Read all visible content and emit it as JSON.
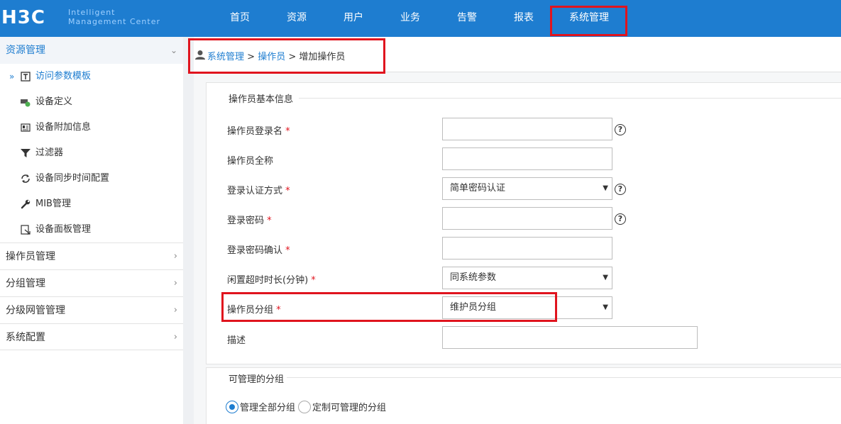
{
  "header": {
    "logo_sub1": "Intelligent",
    "logo_sub2": "Management Center",
    "nav": [
      "首页",
      "资源",
      "用户",
      "业务",
      "告警",
      "报表",
      "系统管理"
    ],
    "colors": {
      "brand": "#1e7dd0",
      "highlight": "#e0141e"
    }
  },
  "sidebar": {
    "section_title": "资源管理",
    "items": [
      {
        "label": "访问参数模板",
        "icon": "template-icon",
        "active": true
      },
      {
        "label": "设备定义",
        "icon": "device-definition-icon"
      },
      {
        "label": "设备附加信息",
        "icon": "device-info-icon"
      },
      {
        "label": "过滤器",
        "icon": "filter-icon"
      },
      {
        "label": "设备同步时间配置",
        "icon": "sync-icon"
      },
      {
        "label": "MIB管理",
        "icon": "wrench-icon"
      },
      {
        "label": "设备面板管理",
        "icon": "panel-icon"
      }
    ],
    "groups": [
      "操作员管理",
      "分组管理",
      "分级网管管理",
      "系统配置"
    ]
  },
  "breadcrumb": {
    "root": "系统管理",
    "sep1": ">",
    "mid": "操作员",
    "sep2": ">",
    "current": "增加操作员"
  },
  "form": {
    "legend": "操作员基本信息",
    "login_name_label": "操作员登录名",
    "full_name_label": "操作员全称",
    "auth_label": "登录认证方式",
    "auth_value": "简单密码认证",
    "password_label": "登录密码",
    "password_confirm_label": "登录密码确认",
    "idle_label": "闲置超时时长(分钟)",
    "idle_value": "同系统参数",
    "group_label": "操作员分组",
    "group_value": "维护员分组",
    "desc_label": "描述",
    "required_mark": "*"
  },
  "manage": {
    "legend": "可管理的分组",
    "all_label": "管理全部分组",
    "custom_label": "定制可管理的分组"
  }
}
